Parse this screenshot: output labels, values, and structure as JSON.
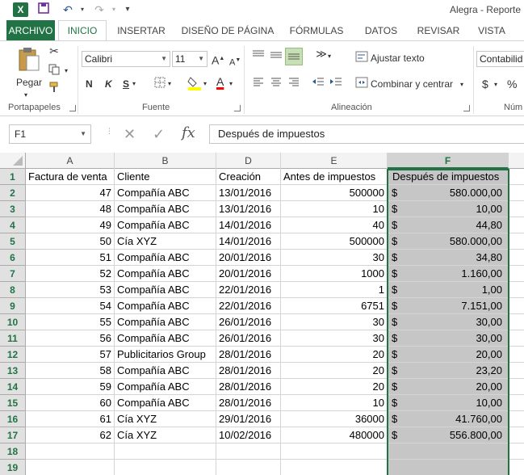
{
  "window": {
    "title": "Alegra - Reporte",
    "app_icon": "excel-icon"
  },
  "quick_access": {
    "save_icon": "save-icon",
    "undo_icon": "undo-icon",
    "redo_icon": "redo-icon"
  },
  "tabs": [
    {
      "label": "ARCHIVO"
    },
    {
      "label": "INICIO"
    },
    {
      "label": "INSERTAR"
    },
    {
      "label": "DISEÑO DE PÁGINA"
    },
    {
      "label": "FÓRMULAS"
    },
    {
      "label": "DATOS"
    },
    {
      "label": "REVISAR"
    },
    {
      "label": "VISTA"
    }
  ],
  "ribbon": {
    "clipboard": {
      "paste_label": "Pegar",
      "group_label": "Portapapeles"
    },
    "font": {
      "font_name": "Calibri",
      "font_size": "11",
      "bold": "N",
      "italic": "K",
      "underline": "S",
      "group_label": "Fuente",
      "grow": "A",
      "shrink": "A",
      "font_color": "A"
    },
    "alignment": {
      "wrap_label": "Ajustar texto",
      "merge_label": "Combinar y centrar",
      "group_label": "Alineación"
    },
    "number": {
      "format": "Contabilid",
      "currency": "$",
      "percent": "%",
      "group_label": "Núm"
    }
  },
  "formula_bar": {
    "name_box": "F1",
    "fx": "fx",
    "content": "Después de impuestos"
  },
  "sheet": {
    "columns": [
      "A",
      "B",
      "D",
      "E",
      "F"
    ],
    "selected_column": "F",
    "headers": {
      "a": "Factura de venta",
      "b": "Cliente",
      "d": "Creación",
      "e": "Antes de impuestos",
      "f": "Después de impuestos"
    },
    "currency_symbol": "$",
    "rows": [
      {
        "n": "1"
      },
      {
        "n": "2",
        "a": "47",
        "b": "Compañía ABC",
        "d": "13/01/2016",
        "e": "500000",
        "f": "580.000,00"
      },
      {
        "n": "3",
        "a": "48",
        "b": "Compañía ABC",
        "d": "13/01/2016",
        "e": "10",
        "f": "10,00"
      },
      {
        "n": "4",
        "a": "49",
        "b": "Compañía ABC",
        "d": "14/01/2016",
        "e": "40",
        "f": "44,80"
      },
      {
        "n": "5",
        "a": "50",
        "b": "Cía XYZ",
        "d": "14/01/2016",
        "e": "500000",
        "f": "580.000,00"
      },
      {
        "n": "6",
        "a": "51",
        "b": "Compañía ABC",
        "d": "20/01/2016",
        "e": "30",
        "f": "34,80"
      },
      {
        "n": "7",
        "a": "52",
        "b": "Compañía ABC",
        "d": "20/01/2016",
        "e": "1000",
        "f": "1.160,00"
      },
      {
        "n": "8",
        "a": "53",
        "b": "Compañía ABC",
        "d": "22/01/2016",
        "e": "1",
        "f": "1,00"
      },
      {
        "n": "9",
        "a": "54",
        "b": "Compañía ABC",
        "d": "22/01/2016",
        "e": "6751",
        "f": "7.151,00"
      },
      {
        "n": "10",
        "a": "55",
        "b": "Compañía ABC",
        "d": "26/01/2016",
        "e": "30",
        "f": "30,00"
      },
      {
        "n": "11",
        "a": "56",
        "b": "Compañía ABC",
        "d": "26/01/2016",
        "e": "30",
        "f": "30,00"
      },
      {
        "n": "12",
        "a": "57",
        "b": "Publicitarios Group",
        "d": "28/01/2016",
        "e": "20",
        "f": "20,00"
      },
      {
        "n": "13",
        "a": "58",
        "b": "Compañía ABC",
        "d": "28/01/2016",
        "e": "20",
        "f": "23,20"
      },
      {
        "n": "14",
        "a": "59",
        "b": "Compañía ABC",
        "d": "28/01/2016",
        "e": "20",
        "f": "20,00"
      },
      {
        "n": "15",
        "a": "60",
        "b": "Compañía ABC",
        "d": "28/01/2016",
        "e": "10",
        "f": "10,00"
      },
      {
        "n": "16",
        "a": "61",
        "b": "Cía XYZ",
        "d": "29/01/2016",
        "e": "36000",
        "f": "41.760,00"
      },
      {
        "n": "17",
        "a": "62",
        "b": "Cía XYZ",
        "d": "10/02/2016",
        "e": "480000",
        "f": "556.800,00"
      },
      {
        "n": "18"
      },
      {
        "n": "19"
      }
    ]
  },
  "colors": {
    "accent": "#217346",
    "selection": "#c6c6c6"
  }
}
